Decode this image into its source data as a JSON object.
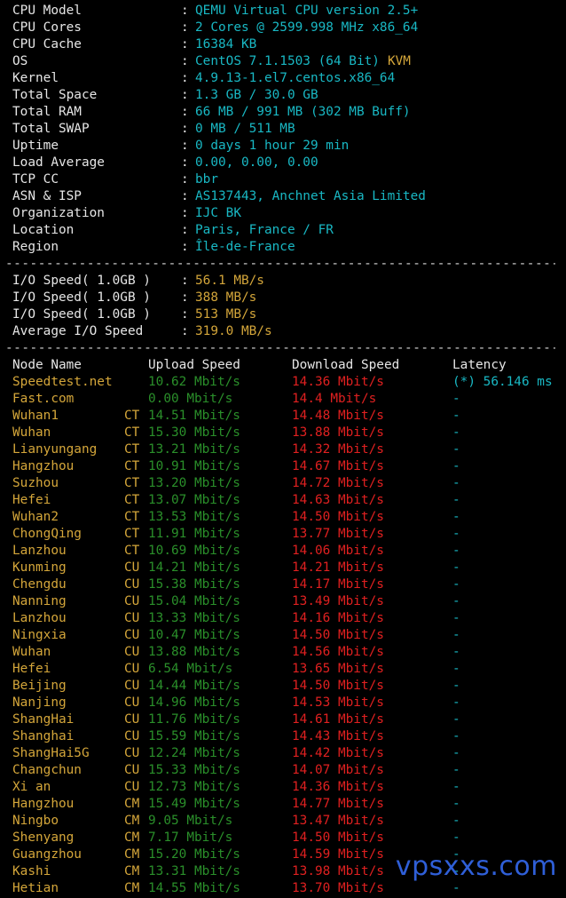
{
  "colors": {
    "background": "#000000",
    "label": "#e6e6e6",
    "cyan": "#19b8c4",
    "yellow": "#d4a63a",
    "green": "#2a8f2a",
    "red": "#e02020",
    "watermark": "#2f5fd8"
  },
  "sysinfo": [
    {
      "key": "CPU Model",
      "value": "QEMU Virtual CPU version 2.5+",
      "extra": ""
    },
    {
      "key": "CPU Cores",
      "value": "2 Cores @ 2599.998 MHz x86_64",
      "extra": ""
    },
    {
      "key": "CPU Cache",
      "value": "16384 KB",
      "extra": ""
    },
    {
      "key": "OS",
      "value": "CentOS 7.1.1503 (64 Bit)",
      "extra": "KVM"
    },
    {
      "key": "Kernel",
      "value": "4.9.13-1.el7.centos.x86_64",
      "extra": ""
    },
    {
      "key": "Total Space",
      "value": "1.3 GB / 30.0 GB",
      "extra": ""
    },
    {
      "key": "Total RAM",
      "value": "66 MB / 991 MB (302 MB Buff)",
      "extra": ""
    },
    {
      "key": "Total SWAP",
      "value": "0 MB / 511 MB",
      "extra": ""
    },
    {
      "key": "Uptime",
      "value": "0 days 1 hour 29 min",
      "extra": ""
    },
    {
      "key": "Load Average",
      "value": "0.00, 0.00, 0.00",
      "extra": ""
    },
    {
      "key": "TCP CC",
      "value": "bbr",
      "extra": ""
    },
    {
      "key": "ASN & ISP",
      "value": "AS137443, Anchnet Asia Limited",
      "extra": ""
    },
    {
      "key": "Organization",
      "value": "IJC BK",
      "extra": ""
    },
    {
      "key": "Location",
      "value": "Paris, France / FR",
      "extra": ""
    },
    {
      "key": "Region",
      "value": "Île-de-France",
      "extra": ""
    }
  ],
  "separator": "--------------------------------------------------------------------------",
  "colon": ":",
  "io": [
    {
      "key": "I/O Speed( 1.0GB )",
      "value": "56.1 MB/s"
    },
    {
      "key": "I/O Speed( 1.0GB )",
      "value": "388 MB/s"
    },
    {
      "key": "I/O Speed( 1.0GB )",
      "value": "513 MB/s"
    },
    {
      "key": "Average I/O Speed",
      "value": "319.0 MB/s"
    }
  ],
  "speed_headers": {
    "node": "Node Name",
    "upload": "Upload Speed",
    "download": "Download Speed",
    "latency": "Latency"
  },
  "speed_rows": [
    {
      "node": "Speedtest.net",
      "isp": "",
      "up": "10.62 Mbit/s",
      "down": "14.36 Mbit/s",
      "lat": "(*) 56.146 ms"
    },
    {
      "node": "Fast.com",
      "isp": "",
      "up": "0.00 Mbit/s",
      "down": "14.4 Mbit/s",
      "lat": "-"
    },
    {
      "node": "Wuhan1",
      "isp": "CT",
      "up": "14.51 Mbit/s",
      "down": "14.48 Mbit/s",
      "lat": "-"
    },
    {
      "node": "Wuhan",
      "isp": "CT",
      "up": "15.30 Mbit/s",
      "down": "13.88 Mbit/s",
      "lat": "-"
    },
    {
      "node": "Lianyungang",
      "isp": "CT",
      "up": "13.21 Mbit/s",
      "down": "14.32 Mbit/s",
      "lat": "-"
    },
    {
      "node": "Hangzhou",
      "isp": "CT",
      "up": "10.91 Mbit/s",
      "down": "14.67 Mbit/s",
      "lat": "-"
    },
    {
      "node": "Suzhou",
      "isp": "CT",
      "up": "13.20 Mbit/s",
      "down": "14.72 Mbit/s",
      "lat": "-"
    },
    {
      "node": "Hefei",
      "isp": "CT",
      "up": "13.07 Mbit/s",
      "down": "14.63 Mbit/s",
      "lat": "-"
    },
    {
      "node": "Wuhan2",
      "isp": "CT",
      "up": "13.53 Mbit/s",
      "down": "14.50 Mbit/s",
      "lat": "-"
    },
    {
      "node": "ChongQing",
      "isp": "CT",
      "up": "11.91 Mbit/s",
      "down": "13.77 Mbit/s",
      "lat": "-"
    },
    {
      "node": "Lanzhou",
      "isp": "CT",
      "up": "10.69 Mbit/s",
      "down": "14.06 Mbit/s",
      "lat": "-"
    },
    {
      "node": "Kunming",
      "isp": "CU",
      "up": "14.21 Mbit/s",
      "down": "14.21 Mbit/s",
      "lat": "-"
    },
    {
      "node": "Chengdu",
      "isp": "CU",
      "up": "15.38 Mbit/s",
      "down": "14.17 Mbit/s",
      "lat": "-"
    },
    {
      "node": "Nanning",
      "isp": "CU",
      "up": "15.04 Mbit/s",
      "down": "13.49 Mbit/s",
      "lat": "-"
    },
    {
      "node": "Lanzhou",
      "isp": "CU",
      "up": "13.33 Mbit/s",
      "down": "14.16 Mbit/s",
      "lat": "-"
    },
    {
      "node": "Ningxia",
      "isp": "CU",
      "up": "10.47 Mbit/s",
      "down": "14.50 Mbit/s",
      "lat": "-"
    },
    {
      "node": "Wuhan",
      "isp": "CU",
      "up": "13.88 Mbit/s",
      "down": "14.56 Mbit/s",
      "lat": "-"
    },
    {
      "node": "Hefei",
      "isp": "CU",
      "up": "6.54 Mbit/s",
      "down": "13.65 Mbit/s",
      "lat": "-"
    },
    {
      "node": "Beijing",
      "isp": "CU",
      "up": "14.44 Mbit/s",
      "down": "14.50 Mbit/s",
      "lat": "-"
    },
    {
      "node": "Nanjing",
      "isp": "CU",
      "up": "14.96 Mbit/s",
      "down": "14.53 Mbit/s",
      "lat": "-"
    },
    {
      "node": "ShangHai",
      "isp": "CU",
      "up": "11.76 Mbit/s",
      "down": "14.61 Mbit/s",
      "lat": "-"
    },
    {
      "node": "Shanghai",
      "isp": "CU",
      "up": "15.59 Mbit/s",
      "down": "14.43 Mbit/s",
      "lat": "-"
    },
    {
      "node": "ShangHai5G",
      "isp": "CU",
      "up": "12.24 Mbit/s",
      "down": "14.42 Mbit/s",
      "lat": "-"
    },
    {
      "node": "Changchun",
      "isp": "CU",
      "up": "15.33 Mbit/s",
      "down": "14.07 Mbit/s",
      "lat": "-"
    },
    {
      "node": "Xi an",
      "isp": "CU",
      "up": "12.73 Mbit/s",
      "down": "14.36 Mbit/s",
      "lat": "-"
    },
    {
      "node": "Hangzhou",
      "isp": "CM",
      "up": "15.49 Mbit/s",
      "down": "14.77 Mbit/s",
      "lat": "-"
    },
    {
      "node": "Ningbo",
      "isp": "CM",
      "up": "9.05 Mbit/s",
      "down": "13.47 Mbit/s",
      "lat": "-"
    },
    {
      "node": "Shenyang",
      "isp": "CM",
      "up": "7.17 Mbit/s",
      "down": "14.50 Mbit/s",
      "lat": "-"
    },
    {
      "node": "Guangzhou",
      "isp": "CM",
      "up": "15.20 Mbit/s",
      "down": "14.59 Mbit/s",
      "lat": "-"
    },
    {
      "node": "Kashi",
      "isp": "CM",
      "up": "13.31 Mbit/s",
      "down": "13.98 Mbit/s",
      "lat": "-"
    },
    {
      "node": "Hetian",
      "isp": "CM",
      "up": "14.55 Mbit/s",
      "down": "13.70 Mbit/s",
      "lat": "-"
    }
  ],
  "watermark": "vpsxxs.com"
}
